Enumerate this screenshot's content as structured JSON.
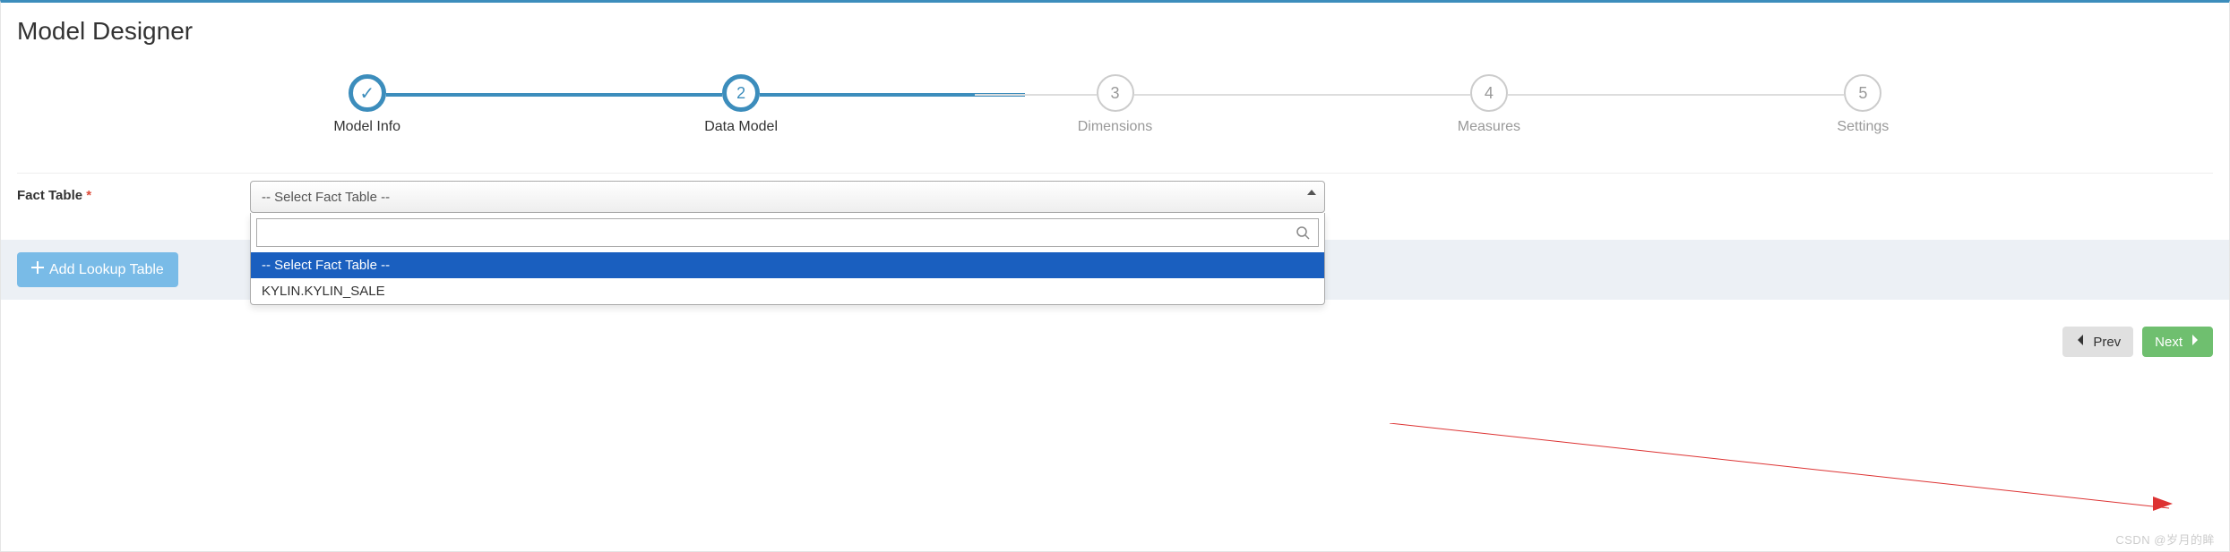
{
  "title": "Model Designer",
  "stepper": {
    "steps": [
      {
        "label": "Model Info",
        "status": "done",
        "marker": "✓"
      },
      {
        "label": "Data Model",
        "status": "active",
        "marker": "2"
      },
      {
        "label": "Dimensions",
        "status": "pending",
        "marker": "3"
      },
      {
        "label": "Measures",
        "status": "pending",
        "marker": "4"
      },
      {
        "label": "Settings",
        "status": "pending",
        "marker": "5"
      }
    ]
  },
  "form": {
    "fact_table_label": "Fact Table",
    "fact_table_required": "*",
    "fact_table_placeholder": "-- Select Fact Table --"
  },
  "dropdown": {
    "search_value": "",
    "options": [
      {
        "label": "-- Select Fact Table --",
        "selected": true
      },
      {
        "label": "KYLIN.KYLIN_SALE",
        "selected": false
      }
    ]
  },
  "lookup": {
    "add_button_label": "Add Lookup Table"
  },
  "footer": {
    "prev_label": "Prev",
    "next_label": "Next"
  },
  "watermark": "CSDN @岁月的眸"
}
